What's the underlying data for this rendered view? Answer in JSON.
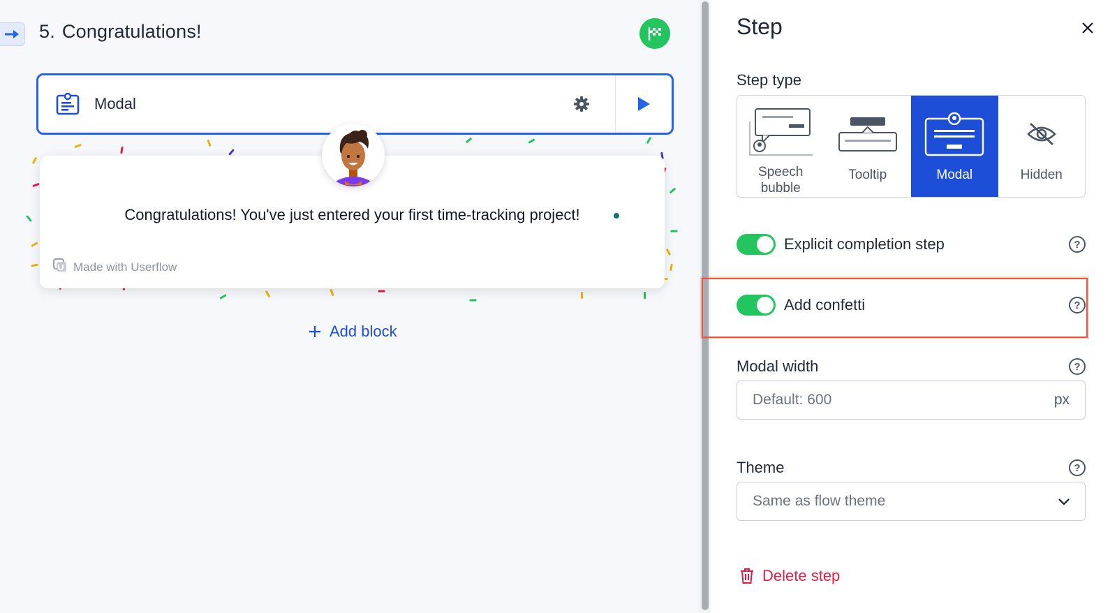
{
  "canvas": {
    "step_number": "5.",
    "step_title": "Congratulations!",
    "block": {
      "label": "Modal"
    },
    "modal_preview": {
      "message": "Congratulations! You've just entered your first time-tracking project!",
      "branding": "Made with Userflow"
    },
    "add_block_label": "Add block"
  },
  "panel": {
    "title": "Step",
    "step_type": {
      "label": "Step type",
      "options": [
        {
          "label": "Speech bubble",
          "selected": false,
          "icon": "speech-bubble-icon"
        },
        {
          "label": "Tooltip",
          "selected": false,
          "icon": "tooltip-icon"
        },
        {
          "label": "Modal",
          "selected": true,
          "icon": "modal-icon"
        },
        {
          "label": "Hidden",
          "selected": false,
          "icon": "eye-off-icon"
        }
      ]
    },
    "explicit_completion": {
      "label": "Explicit completion step",
      "enabled": true
    },
    "add_confetti": {
      "label": "Add confetti",
      "enabled": true
    },
    "modal_width": {
      "label": "Modal width",
      "placeholder": "Default: 600",
      "unit": "px"
    },
    "theme": {
      "label": "Theme",
      "value": "Same as flow theme"
    },
    "delete_label": "Delete step"
  },
  "colors": {
    "accent": "#1d4ed8",
    "toggle_on": "#22c55e",
    "danger": "#e11d48",
    "highlight": "#e5573f"
  }
}
